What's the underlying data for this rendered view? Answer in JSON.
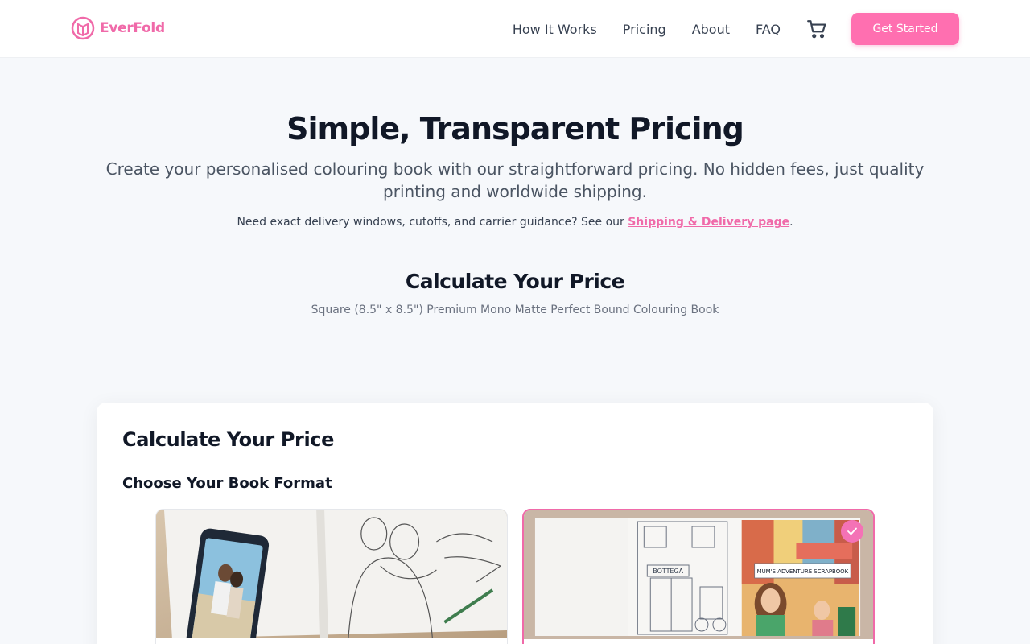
{
  "brand": {
    "name": "EverFold",
    "accent": "#f06aa9"
  },
  "nav": {
    "items": [
      "How It Works",
      "Pricing",
      "About",
      "FAQ"
    ],
    "cart_icon": "cart-icon",
    "cta_label": "Get Started"
  },
  "hero": {
    "title": "Simple, Transparent Pricing",
    "subtitle": "Create your personalised colouring book with our straightforward pricing. No hidden fees, just quality printing and worldwide shipping.",
    "note_prefix": "Need exact delivery windows, cutoffs, and carrier guidance? See our ",
    "note_link": "Shipping & Delivery page",
    "note_suffix": "."
  },
  "calculator": {
    "heading": "Calculate Your Price",
    "product": "Square (8.5\" x 8.5\") Premium Mono Matte Perfect Bound Colouring Book",
    "card_title": "Calculate Your Price",
    "format_heading": "Choose Your Book Format",
    "scrapbook_label": "MUM'S ADVENTURE SCRAPBOOK",
    "shop_sign": "BOTTEGA",
    "selected_format": 1
  }
}
